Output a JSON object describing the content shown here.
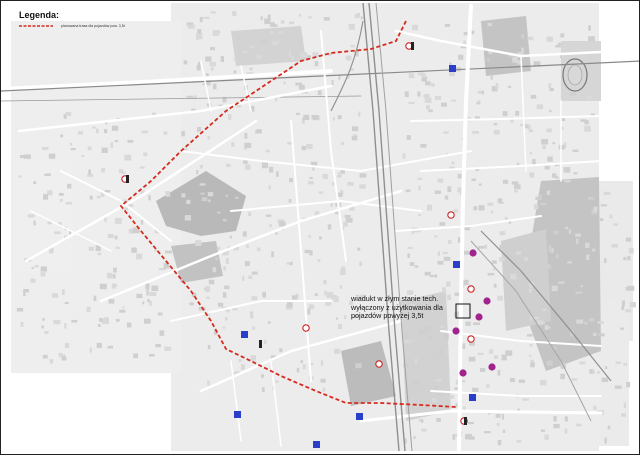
{
  "legend": {
    "title": "Legenda:",
    "route_label": "planowana trasa dla pojazdów pow. 3,5t"
  },
  "annotation": {
    "text": "wiadukt w złym stanie tech. wyłączony z użytkowania dla pojazdów powyżej 3,5t"
  },
  "colors": {
    "route": "#d62a1e",
    "street": "#ffffff",
    "block": "#e6e6e6",
    "building": "#c9c9c9",
    "industrial": "#bdbdbd",
    "railway": "#8f8f8f",
    "sign_blue": "#2a3fc9",
    "sign_magenta": "#a0238e"
  },
  "icons": [
    "road-sign-icon",
    "information-sign-icon",
    "traffic-light-icon",
    "magenta-marker-icon"
  ]
}
